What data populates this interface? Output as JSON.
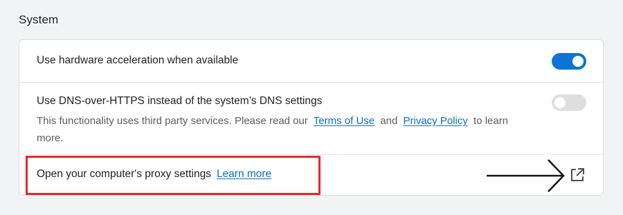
{
  "section": {
    "title": "System"
  },
  "settings": {
    "hardware_acceleration": {
      "label": "Use hardware acceleration when available",
      "enabled": true
    },
    "dns_over_https": {
      "label": "Use DNS-over-HTTPS instead of the system’s DNS settings",
      "description_prefix": "This functionality uses third party services. Please read our",
      "terms_link": "Terms of Use",
      "and_text": "and",
      "privacy_link": "Privacy Policy",
      "description_suffix": "to learn more.",
      "enabled": false
    },
    "proxy": {
      "label": "Open your computer's proxy settings",
      "learn_more_link": "Learn more",
      "icon": "external-link-icon"
    }
  },
  "colors": {
    "accent": "#0c74d5",
    "link": "#0a6dc2",
    "highlight": "#e8262b"
  }
}
